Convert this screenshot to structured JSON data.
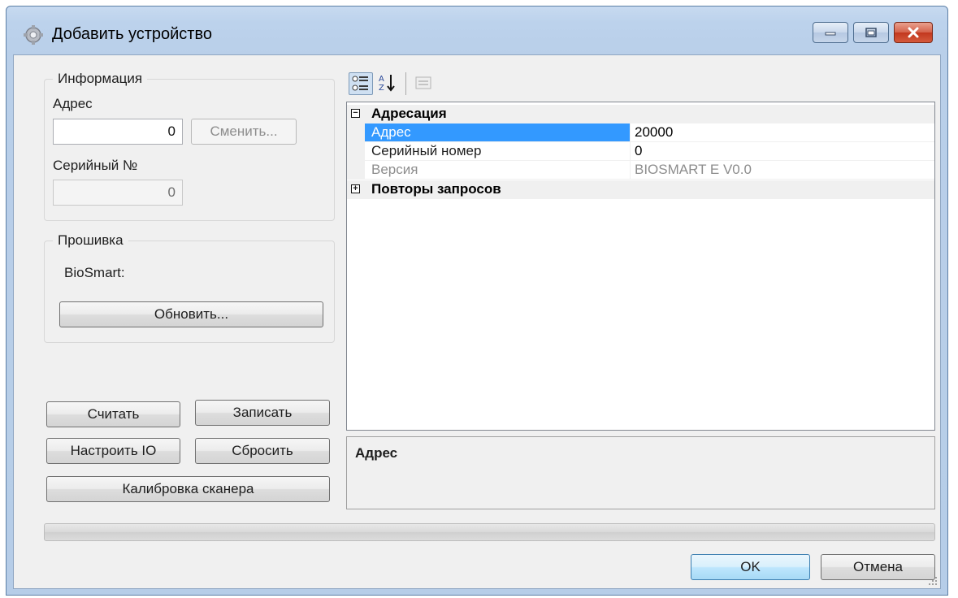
{
  "window": {
    "title": "Добавить устройство",
    "minimize_icon": "minimize-icon",
    "maximize_icon": "maximize-icon",
    "close_icon": "close-icon",
    "app_icon": "gear-icon"
  },
  "info_group": {
    "title": "Информация",
    "address_label": "Адрес",
    "address_value": "0",
    "change_button": "Сменить...",
    "serial_label": "Серийный №",
    "serial_value": "0"
  },
  "firmware_group": {
    "title": "Прошивка",
    "device_label": "BioSmart:",
    "update_button": "Обновить..."
  },
  "buttons": {
    "read": "Считать",
    "write": "Записать",
    "configure_io": "Настроить IO",
    "reset": "Сбросить",
    "calibrate_scanner": "Калибровка сканера",
    "ok": "OK",
    "cancel": "Отмена"
  },
  "property_grid": {
    "toolbar": {
      "categorized_icon": "categorized-icon",
      "alphabetical_icon": "sort-alphabetical-icon",
      "property_pages_icon": "property-pages-icon"
    },
    "categories": [
      {
        "name": "Адресация",
        "expanded": true,
        "properties": [
          {
            "name": "Адрес",
            "value": "20000",
            "selected": true
          },
          {
            "name": "Серийный номер",
            "value": "0"
          },
          {
            "name": "Версия",
            "value": "BIOSMART E V0.0",
            "readonly": true
          }
        ]
      },
      {
        "name": "Повторы запросов",
        "expanded": false
      }
    ],
    "description_title": "Адрес"
  },
  "colors": {
    "selection": "#3399ff",
    "window_frame": "#b9cfe9",
    "close_button": "#c7432a"
  }
}
